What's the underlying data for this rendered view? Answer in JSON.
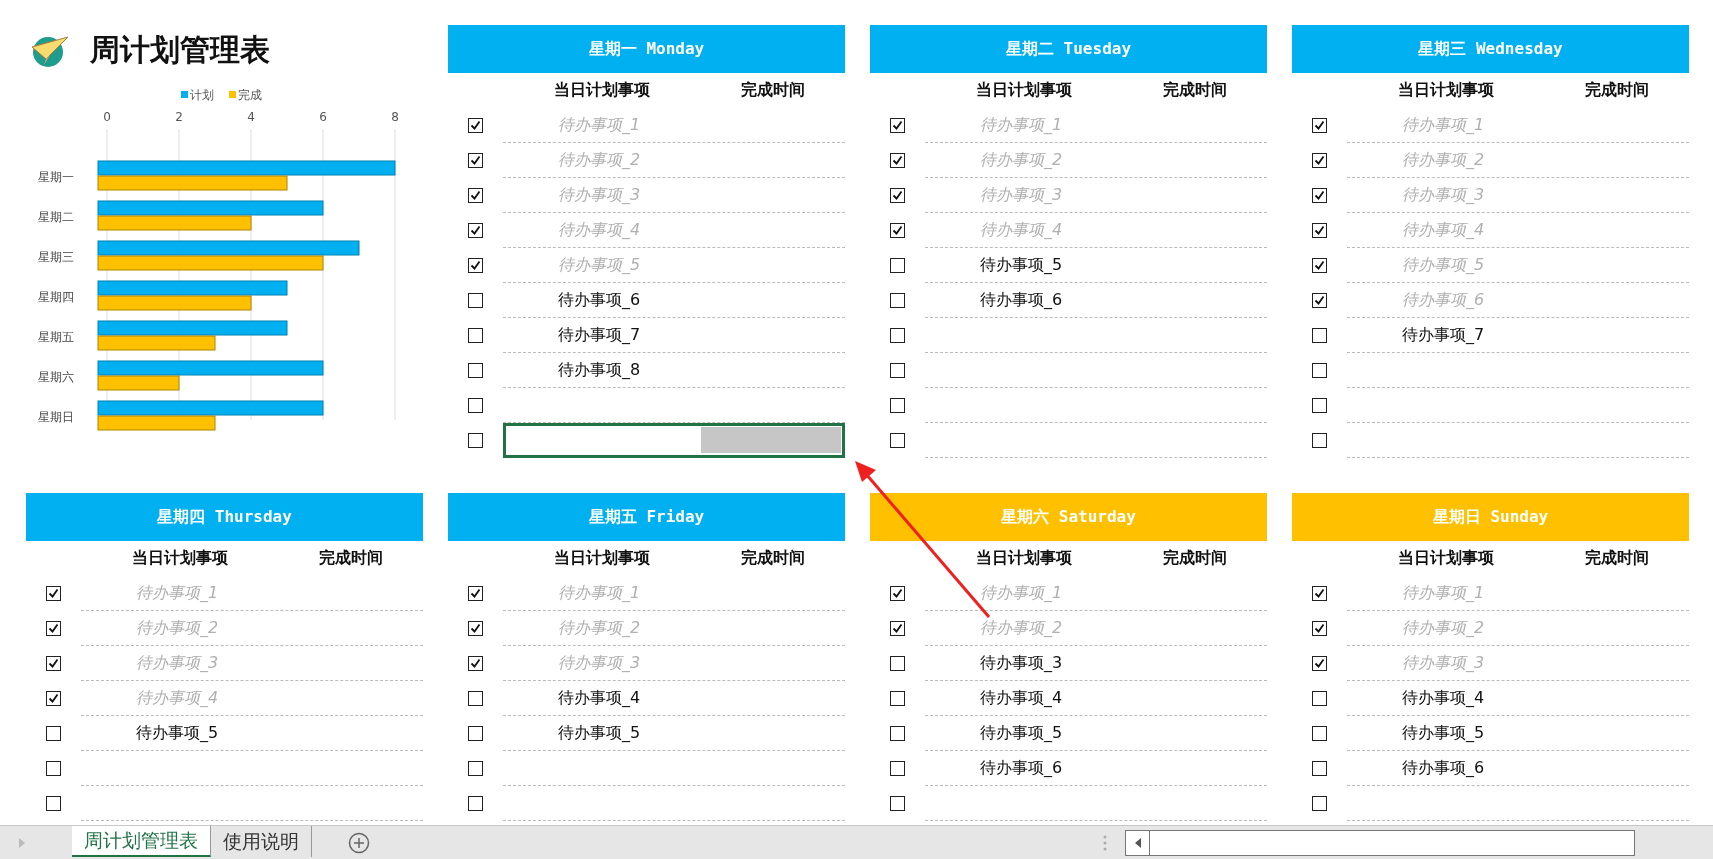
{
  "title": "周计划管理表",
  "chart": {
    "chart_data": {
      "type": "bar",
      "orientation": "horizontal",
      "categories": [
        "星期一",
        "星期二",
        "星期三",
        "星期四",
        "星期五",
        "星期六",
        "星期日"
      ],
      "series": [
        {
          "name": "计划",
          "color": "#00b0f0",
          "values": [
            8,
            6,
            7,
            5,
            5,
            6,
            6
          ]
        },
        {
          "name": "完成",
          "color": "#ffc000",
          "values": [
            5,
            4,
            6,
            4,
            3,
            2,
            3
          ]
        }
      ],
      "xlim": [
        0,
        8
      ],
      "xticks": [
        0,
        2,
        4,
        6,
        8
      ],
      "grid": true,
      "legend": true
    }
  },
  "days": [
    {
      "title": "星期一 Monday",
      "color": "#00b0f0",
      "columns": [
        "当日计划事项",
        "完成时间"
      ],
      "rows": [
        {
          "checked": true,
          "task": "待办事项_1",
          "selected": false
        },
        {
          "checked": true,
          "task": "待办事项_2",
          "selected": false
        },
        {
          "checked": true,
          "task": "待办事项_3",
          "selected": false
        },
        {
          "checked": true,
          "task": "待办事项_4",
          "selected": false
        },
        {
          "checked": true,
          "task": "待办事项_5",
          "selected": false
        },
        {
          "checked": false,
          "task": "待办事项_6",
          "selected": false
        },
        {
          "checked": false,
          "task": "待办事项_7",
          "selected": false
        },
        {
          "checked": false,
          "task": "待办事项_8",
          "selected": false
        },
        {
          "checked": false,
          "selected": false
        },
        {
          "checked": false,
          "selected": true
        }
      ]
    },
    {
      "title": "星期二 Tuesday",
      "color": "#00b0f0",
      "columns": [
        "当日计划事项",
        "完成时间"
      ],
      "rows": [
        {
          "checked": true,
          "task": "待办事项_1",
          "selected": false
        },
        {
          "checked": true,
          "task": "待办事项_2",
          "selected": false
        },
        {
          "checked": true,
          "task": "待办事项_3",
          "selected": false
        },
        {
          "checked": true,
          "task": "待办事项_4",
          "selected": false
        },
        {
          "checked": false,
          "task": "待办事项_5",
          "selected": false
        },
        {
          "checked": false,
          "task": "待办事项_6",
          "selected": false
        },
        {
          "checked": false,
          "selected": false
        },
        {
          "checked": false,
          "selected": false
        },
        {
          "checked": false,
          "selected": false
        },
        {
          "checked": false,
          "selected": false
        }
      ]
    },
    {
      "title": "星期三 Wednesday",
      "color": "#00b0f0",
      "columns": [
        "当日计划事项",
        "完成时间"
      ],
      "rows": [
        {
          "checked": true,
          "task": "待办事项_1",
          "selected": false
        },
        {
          "checked": true,
          "task": "待办事项_2",
          "selected": false
        },
        {
          "checked": true,
          "task": "待办事项_3",
          "selected": false
        },
        {
          "checked": true,
          "task": "待办事项_4",
          "selected": false
        },
        {
          "checked": true,
          "task": "待办事项_5",
          "selected": false
        },
        {
          "checked": true,
          "task": "待办事项_6",
          "selected": false
        },
        {
          "checked": false,
          "task": "待办事项_7",
          "selected": false
        },
        {
          "checked": false,
          "selected": false
        },
        {
          "checked": false,
          "selected": false
        },
        {
          "checked": false,
          "selected": false
        }
      ]
    },
    {
      "title": "星期四 Thursday",
      "color": "#00b0f0",
      "columns": [
        "当日计划事项",
        "完成时间"
      ],
      "rows": [
        {
          "checked": true,
          "task": "待办事项_1",
          "selected": false
        },
        {
          "checked": true,
          "task": "待办事项_2",
          "selected": false
        },
        {
          "checked": true,
          "task": "待办事项_3",
          "selected": false
        },
        {
          "checked": true,
          "task": "待办事项_4",
          "selected": false
        },
        {
          "checked": false,
          "task": "待办事项_5",
          "selected": false
        },
        {
          "checked": false,
          "selected": false
        },
        {
          "checked": false,
          "selected": false
        }
      ]
    },
    {
      "title": "星期五 Friday",
      "color": "#00b0f0",
      "columns": [
        "当日计划事项",
        "完成时间"
      ],
      "rows": [
        {
          "checked": true,
          "task": "待办事项_1",
          "selected": false
        },
        {
          "checked": true,
          "task": "待办事项_2",
          "selected": false
        },
        {
          "checked": true,
          "task": "待办事项_3",
          "selected": false
        },
        {
          "checked": false,
          "task": "待办事项_4",
          "selected": false
        },
        {
          "checked": false,
          "task": "待办事项_5",
          "selected": false
        },
        {
          "checked": false,
          "selected": false
        },
        {
          "checked": false,
          "selected": false
        }
      ]
    },
    {
      "title": "星期六 Saturday",
      "color": "#ffc000",
      "columns": [
        "当日计划事项",
        "完成时间"
      ],
      "rows": [
        {
          "checked": true,
          "task": "待办事项_1",
          "selected": false
        },
        {
          "checked": true,
          "task": "待办事项_2",
          "selected": false
        },
        {
          "checked": false,
          "task": "待办事项_3",
          "selected": false
        },
        {
          "checked": false,
          "task": "待办事项_4",
          "selected": false
        },
        {
          "checked": false,
          "task": "待办事项_5",
          "selected": false
        },
        {
          "checked": false,
          "task": "待办事项_6",
          "selected": false
        },
        {
          "checked": false,
          "selected": false
        }
      ]
    },
    {
      "title": "星期日 Sunday",
      "color": "#ffc000",
      "columns": [
        "当日计划事项",
        "完成时间"
      ],
      "rows": [
        {
          "checked": true,
          "task": "待办事项_1",
          "selected": false
        },
        {
          "checked": true,
          "task": "待办事项_2",
          "selected": false
        },
        {
          "checked": true,
          "task": "待办事项_3",
          "selected": false
        },
        {
          "checked": false,
          "task": "待办事项_4",
          "selected": false
        },
        {
          "checked": false,
          "task": "待办事项_5",
          "selected": false
        },
        {
          "checked": false,
          "task": "待办事项_6",
          "selected": false
        },
        {
          "checked": false,
          "selected": false
        }
      ]
    }
  ],
  "sheet_tabs": [
    {
      "label": "周计划管理表",
      "selected": true
    },
    {
      "label": "使用说明",
      "selected": false
    }
  ]
}
